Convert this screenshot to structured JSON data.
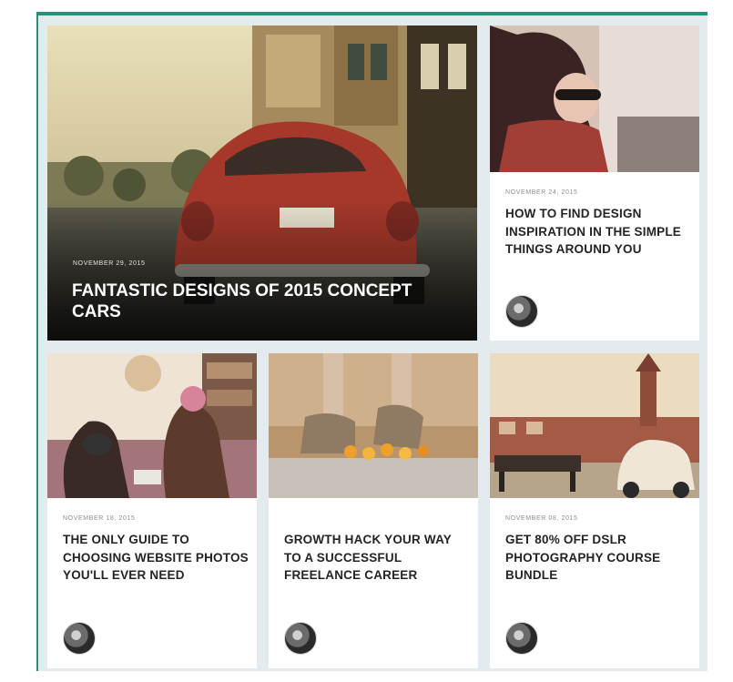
{
  "posts": [
    {
      "date": "November 29, 2015",
      "title": "Fantastic designs of 2015 concept cars",
      "image": "vintage-red-beetle-car-street-photo"
    },
    {
      "date": "November 24, 2015",
      "title": "How to find design inspiration in the simple things around you",
      "image": "woman-sunglasses-scarf-photo"
    },
    {
      "date": "November 18, 2015",
      "title": "The only guide to choosing website photos you'll ever need",
      "image": "two-women-cameras-photo"
    },
    {
      "date": "",
      "title": "Growth hack your way to a successful freelance career",
      "image": "boots-flowers-photo"
    },
    {
      "date": "November 08, 2015",
      "title": "Get 80% off DSLR photography course bundle",
      "image": "old-car-town-square-photo"
    }
  ],
  "colors": {
    "accent": "#2f8c79",
    "background": "#e3ebee",
    "card": "#ffffff",
    "title_text": "#222426"
  },
  "icons": {
    "author": "author-avatar-icon"
  }
}
